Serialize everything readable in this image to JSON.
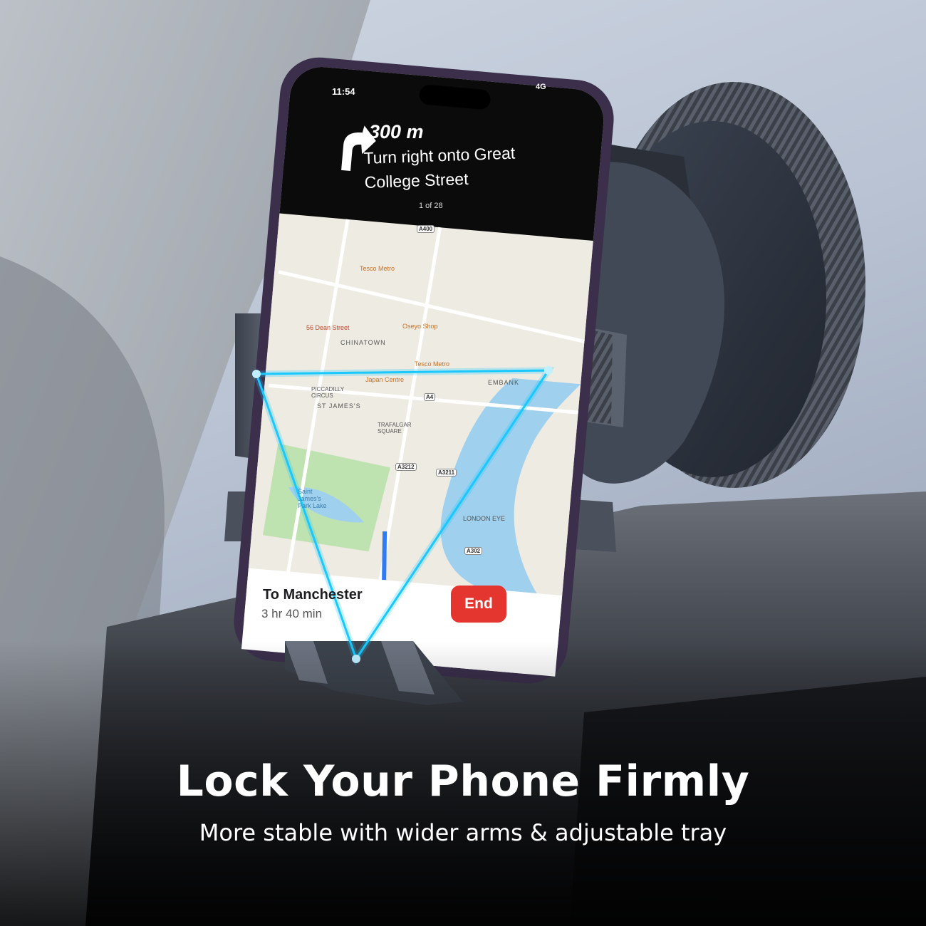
{
  "headline": "Lock Your Phone Firmly",
  "subline": "More stable with wider arms & adjustable tray",
  "phone": {
    "time": "11:54",
    "network": "4G",
    "distance": "300 m",
    "instruction": "Turn right onto Great College Street",
    "step": "1 of 28",
    "destination": "To Manchester",
    "eta": "3 hr 40 min",
    "end_label": "End"
  },
  "map": {
    "labels": [
      "Tesco Metro",
      "56 Dean Street",
      "Oseyo Shop",
      "CHINATOWN",
      "Tesco Metro",
      "Japan Centre",
      "PICCADILLY CIRCUS",
      "ST JAMES'S",
      "TRAFALGAR SQUARE",
      "Saint James's Park Lake",
      "LONDON EYE",
      "EMBANK"
    ],
    "roads": [
      "A400",
      "A4",
      "A3212",
      "A3211",
      "A302"
    ]
  },
  "colors": {
    "accent": "#19c8ff",
    "end": "#e5352f"
  }
}
